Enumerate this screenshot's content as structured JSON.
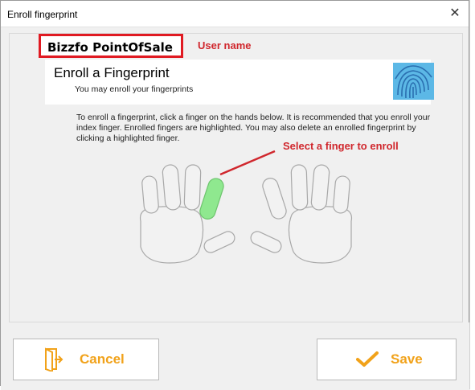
{
  "window": {
    "title": "Enroll fingerprint",
    "close_glyph": "✕"
  },
  "user": {
    "name": "Bizzfo PointOfSale",
    "annotation": "User name"
  },
  "header": {
    "title": "Enroll a Fingerprint",
    "subtitle": "You may enroll your fingerprints",
    "icon": "fingerprint-icon"
  },
  "instructions": "To enroll a fingerprint, click a finger on the hands below. It is recommended that you enroll your index finger. Enrolled fingers are highlighted. You may also delete an enrolled fingerprint by clicking a highlighted finger.",
  "finger_annotation": "Select a finger to enroll",
  "hands": {
    "highlighted_finger": "left-index",
    "highlight_color": "#8fe88f",
    "finger_color": "#f2f2f2"
  },
  "buttons": {
    "cancel": "Cancel",
    "save": "Save",
    "accent": "#f1a21a"
  },
  "annotation_color": "#d0272d"
}
